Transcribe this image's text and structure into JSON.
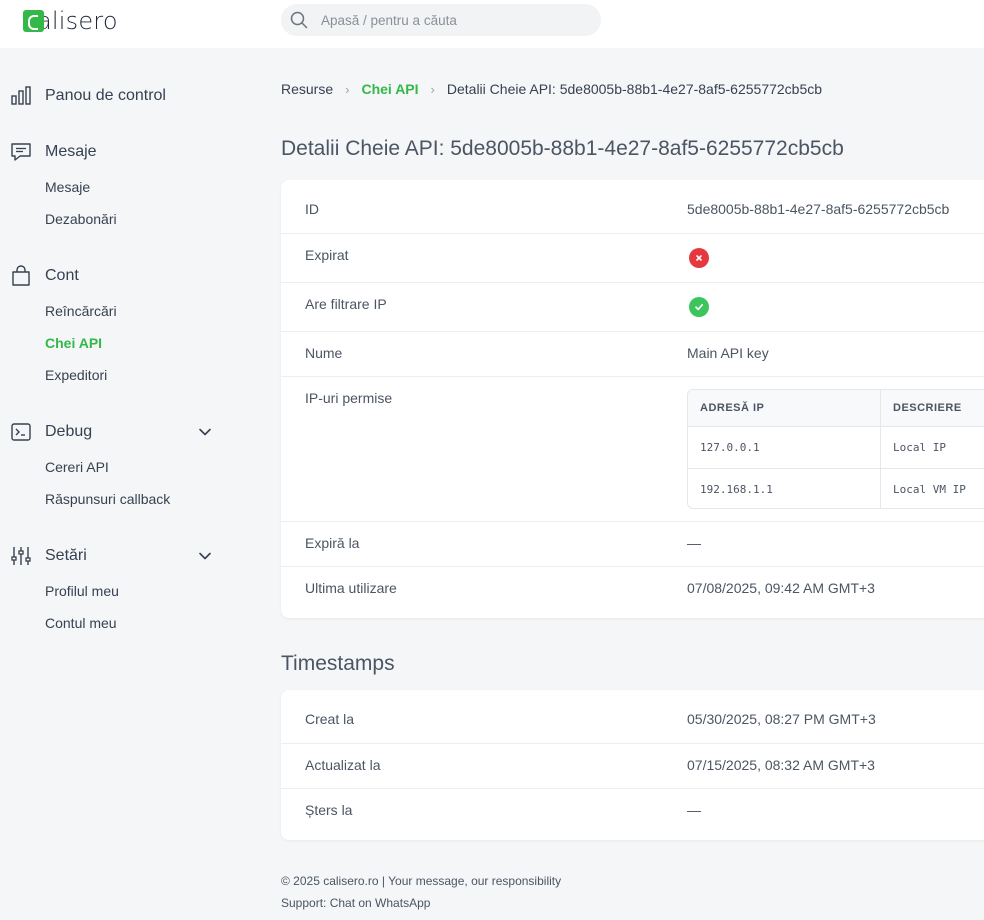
{
  "header": {
    "logo_text": "alisero",
    "search_placeholder": "Apasă / pentru a căuta"
  },
  "sidebar": {
    "dashboard": "Panou de control",
    "messages": {
      "label": "Mesaje",
      "items": [
        "Mesaje",
        "Dezabonări"
      ]
    },
    "account": {
      "label": "Cont",
      "items": [
        "Reîncărcări",
        "Chei API",
        "Expeditori"
      ]
    },
    "debug": {
      "label": "Debug",
      "items": [
        "Cereri API",
        "Răspunsuri callback"
      ]
    },
    "settings": {
      "label": "Setări",
      "items": [
        "Profilul meu",
        "Contul meu"
      ]
    }
  },
  "breadcrumb": [
    "Resurse",
    "Chei API",
    "Detalii Cheie API: 5de8005b-88b1-4e27-8af5-6255772cb5cb"
  ],
  "page_title": "Detalii Cheie API: 5de8005b-88b1-4e27-8af5-6255772cb5cb",
  "details": {
    "id_label": "ID",
    "id_value": "5de8005b-88b1-4e27-8af5-6255772cb5cb",
    "expired_label": "Expirat",
    "expired_value": false,
    "ip_filter_label": "Are filtrare IP",
    "ip_filter_value": true,
    "name_label": "Nume",
    "name_value": "Main API key",
    "allowed_ips_label": "IP-uri permise",
    "ip_table": {
      "headers": [
        "ADRESĂ IP",
        "DESCRIERE"
      ],
      "rows": [
        [
          "127.0.0.1",
          "Local IP"
        ],
        [
          "192.168.1.1",
          "Local VM IP"
        ]
      ]
    },
    "expires_label": "Expiră la",
    "expires_value": "—",
    "last_used_label": "Ultima utilizare",
    "last_used_value": "07/08/2025, 09:42 AM GMT+3"
  },
  "timestamps": {
    "title": "Timestamps",
    "created_label": "Creat la",
    "created_value": "05/30/2025, 08:27 PM GMT+3",
    "updated_label": "Actualizat la",
    "updated_value": "07/15/2025, 08:32 AM GMT+3",
    "deleted_label": "Șters la",
    "deleted_value": "—"
  },
  "footer": {
    "line1": "© 2025 calisero.ro | Your message, our responsibility",
    "line2": "Support: Chat on WhatsApp"
  },
  "colors": {
    "accent": "#35b84a",
    "error": "#e5393f",
    "success": "#3cc55c"
  }
}
